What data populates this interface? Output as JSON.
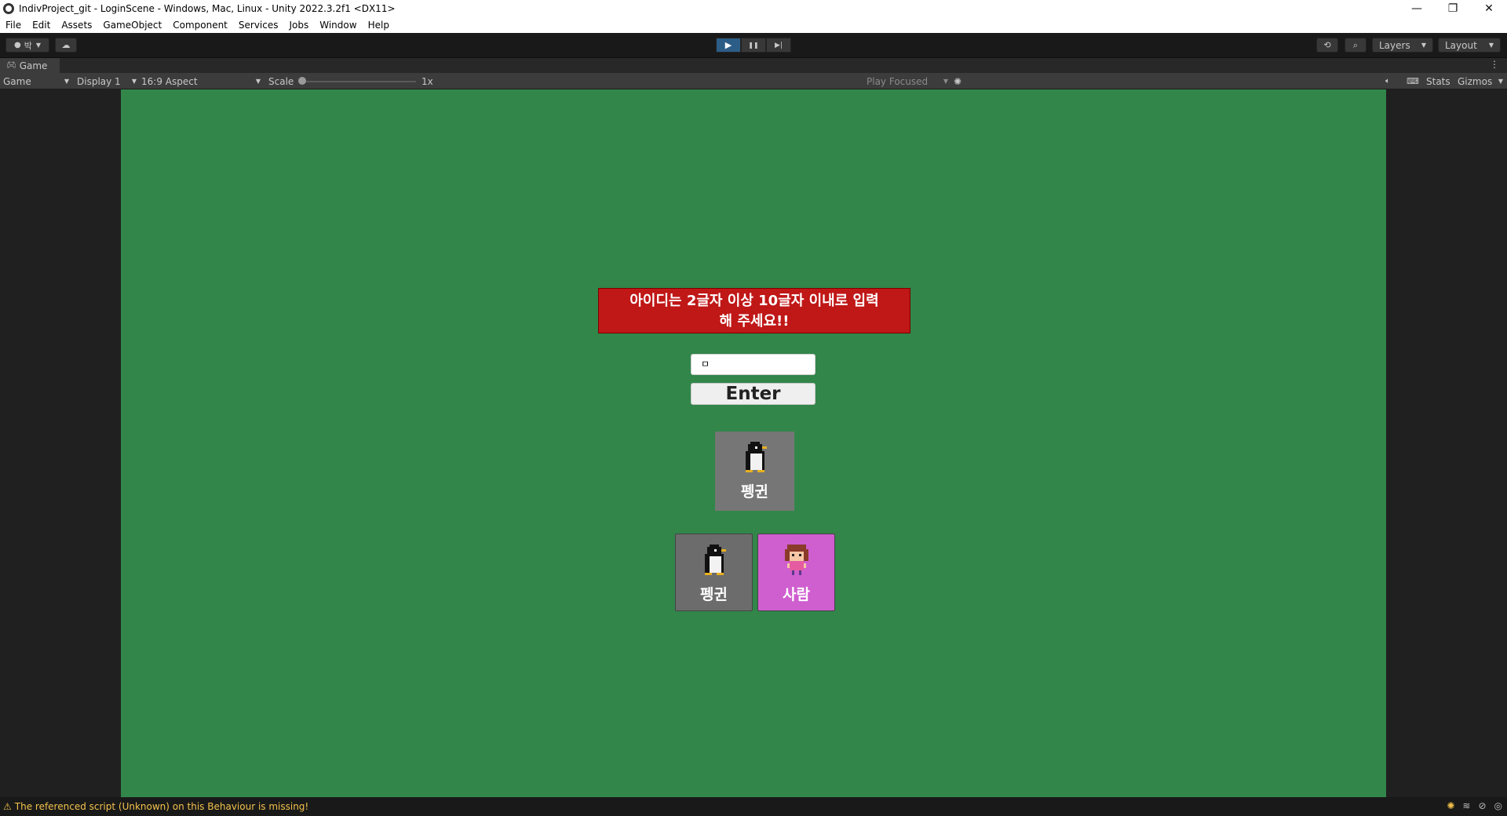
{
  "window": {
    "title": "IndivProject_git - LoginScene - Windows, Mac, Linux - Unity 2022.3.2f1 <DX11>",
    "minimize": "—",
    "restore": "❐",
    "close": "✕"
  },
  "menu": [
    "File",
    "Edit",
    "Assets",
    "GameObject",
    "Component",
    "Services",
    "Jobs",
    "Window",
    "Help"
  ],
  "toolbar": {
    "account_label": "박",
    "play_icon": "▶",
    "pause_icon": "❚❚",
    "step_icon": "▶|",
    "history_icon": "⟲",
    "search_icon": "⌕",
    "layers_label": "Layers",
    "layout_label": "Layout"
  },
  "tab": {
    "label": "Game",
    "menu_icon": "⋮"
  },
  "gamebar": {
    "mode": "Game",
    "display": "Display 1",
    "aspect": "16:9 Aspect",
    "scale_label": "Scale",
    "scale_value": "1x",
    "scale_fraction": 0.0,
    "play_focused": "Play Focused",
    "stats": "Stats",
    "gizmos": "Gizmos"
  },
  "game": {
    "error_line1": "아이디는 2글자 이상 10글자 이내로 입력",
    "error_line2": "해 주세요!!",
    "input_value": "ㅁ",
    "enter_label": "Enter",
    "selected_character": "펭귄",
    "characters": [
      {
        "name": "펭귄",
        "color": "#6c6c6c"
      },
      {
        "name": "사람",
        "color": "#cf5ecf"
      }
    ]
  },
  "status": {
    "message": "The referenced script (Unknown) on this Behaviour is missing!"
  },
  "colors": {
    "game_background": "#32864a",
    "error_background": "#c01717",
    "play_active": "#2c5d87",
    "warning_text": "#f3c24b"
  }
}
